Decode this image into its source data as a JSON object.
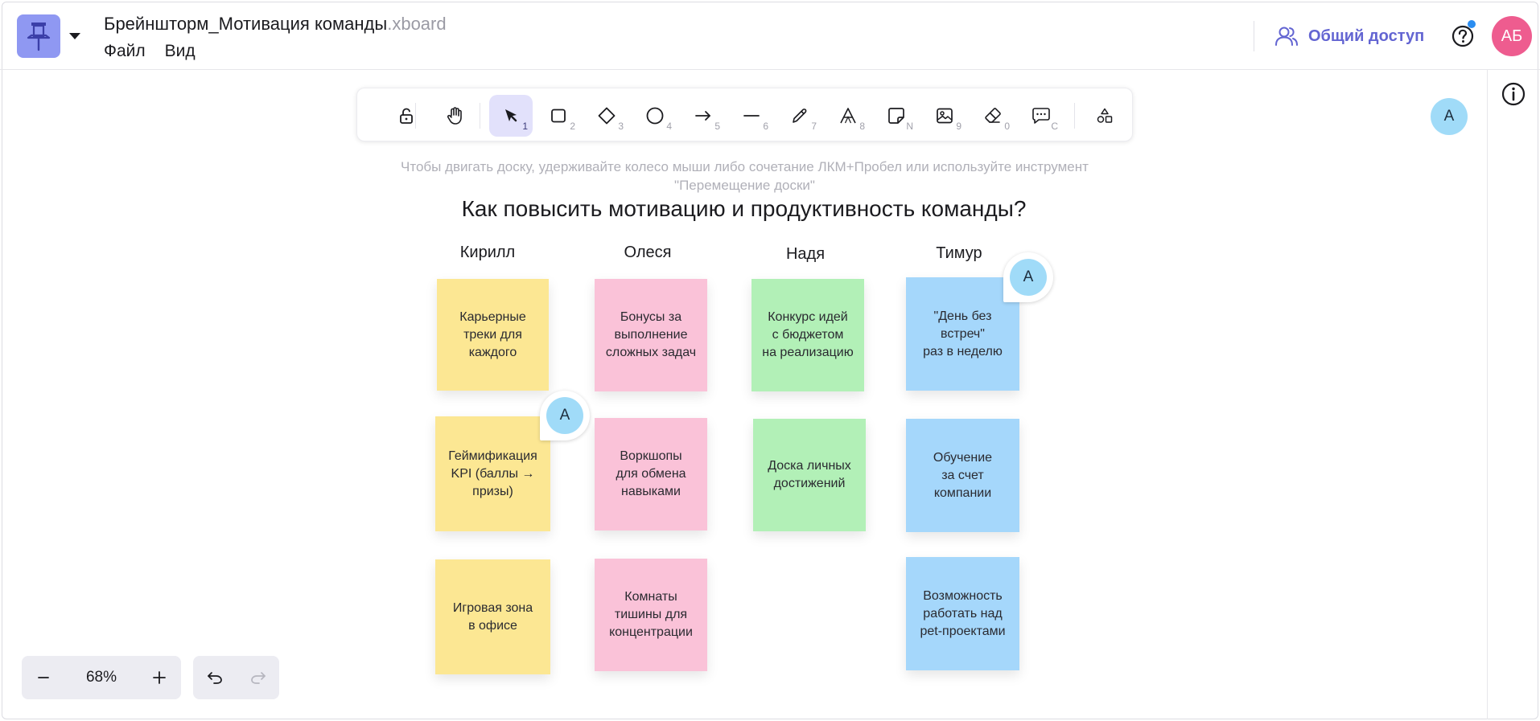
{
  "header": {
    "title": "Брейншторм_Мотивация команды",
    "title_ext": ".xboard",
    "menu": [
      "Файл",
      "Вид"
    ],
    "share_label": "Общий доступ",
    "user_initials": "АБ"
  },
  "toolbar": {
    "tools": [
      {
        "name": "lock-tool",
        "icon": "unlock-icon",
        "key": ""
      },
      {
        "name": "hand-tool",
        "icon": "hand-icon",
        "key": ""
      },
      {
        "name": "select-tool",
        "icon": "cursor-arrow-icon",
        "key": "1",
        "active": true
      },
      {
        "name": "rectangle-tool",
        "icon": "rectangle-icon",
        "key": "2"
      },
      {
        "name": "diamond-tool",
        "icon": "diamond-icon",
        "key": "3"
      },
      {
        "name": "ellipse-tool",
        "icon": "circle-icon",
        "key": "4"
      },
      {
        "name": "arrow-tool",
        "icon": "arrow-right-icon",
        "key": "5"
      },
      {
        "name": "line-tool",
        "icon": "line-icon",
        "key": "6"
      },
      {
        "name": "pencil-tool",
        "icon": "pencil-icon",
        "key": "7"
      },
      {
        "name": "text-tool",
        "icon": "text-icon",
        "key": "8"
      },
      {
        "name": "sticky-note-tool",
        "icon": "sticky-note-icon",
        "key": "N"
      },
      {
        "name": "image-tool",
        "icon": "image-icon",
        "key": "9"
      },
      {
        "name": "eraser-tool",
        "icon": "eraser-icon",
        "key": "0"
      },
      {
        "name": "comment-tool",
        "icon": "comment-icon",
        "key": "C"
      },
      {
        "name": "shapes-tool",
        "icon": "shapes-icon",
        "key": ""
      }
    ]
  },
  "hint": "Чтобы двигать доску, удерживайте колесо мыши либо сочетание ЛКМ+Пробел или используйте инструмент \"Перемещение доски\"",
  "collaborator_initial": "А",
  "board": {
    "title": "Как повысить мотивацию и продуктивность команды?",
    "columns": [
      {
        "name": "Кирилл",
        "color": "#fce793",
        "notes": [
          "Карьерные\nтреки для\nкаждого",
          "Геймификация\nKPI (баллы →\nпризы)",
          "Игровая зона\nв офисе"
        ]
      },
      {
        "name": "Олеся",
        "color": "#fac2d8",
        "notes": [
          "Бонусы за\nвыполнение\nсложных задач",
          "Воркшопы\nдля обмена\nнавыками",
          "Комнаты\nтишины для\nконцентрации"
        ]
      },
      {
        "name": "Надя",
        "color": "#b2f0b7",
        "notes": [
          "Конкурс идей\nс бюджетом\nна реализацию",
          "Доска личных\nдостижений"
        ]
      },
      {
        "name": "Тимур",
        "color": "#a5d7fb",
        "notes": [
          "\"День без\nвстреч\"\nраз в неделю",
          "Обучение\nза счет\nкомпании",
          "Возможность\nработать над\npet-проектами"
        ]
      }
    ]
  },
  "zoom": {
    "value": "68%"
  },
  "colors": {
    "accent": "#6365d2",
    "avatar": "#ee5c8f",
    "collaborator": "#a0dbf8",
    "active_tool": "#e2e1fb"
  }
}
